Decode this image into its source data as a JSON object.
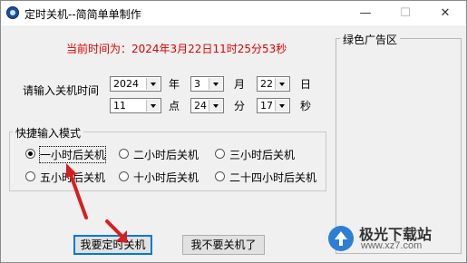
{
  "window": {
    "title": "定时关机--简简单单制作",
    "min_glyph": "—",
    "max_glyph": "☐",
    "close_glyph": "✕"
  },
  "current_time": "当前时间为：2024年3月22日11时25分53秒",
  "shutdown_time": {
    "label": "请输入关机时间",
    "year_value": "2024",
    "year_unit": "年",
    "month_value": "3",
    "month_unit": "月",
    "day_value": "22",
    "day_unit": "日",
    "hour_value": "11",
    "hour_unit": "点",
    "minute_value": "24",
    "minute_unit": "分",
    "second_value": "17",
    "second_unit": "秒"
  },
  "quick_input": {
    "title": "快捷输入模式",
    "options": [
      {
        "label": "一小时后关机",
        "checked": true
      },
      {
        "label": "二小时后关机",
        "checked": false
      },
      {
        "label": "三小时后关机",
        "checked": false
      },
      {
        "label": "五小时后关机",
        "checked": false
      },
      {
        "label": "十小时后关机",
        "checked": false
      },
      {
        "label": "二十四小时后关机",
        "checked": false
      }
    ]
  },
  "ad_area": {
    "title": "绿色广告区"
  },
  "buttons": {
    "shutdown": "我要定时关机",
    "cancel": "我不要关机了"
  },
  "watermark": {
    "brand": "极光下载站",
    "url": "www.xz7.com"
  },
  "colors": {
    "current_time_text": "#e00000",
    "annotation_arrow": "#d81e1e",
    "default_button_border": "#0078d7"
  }
}
